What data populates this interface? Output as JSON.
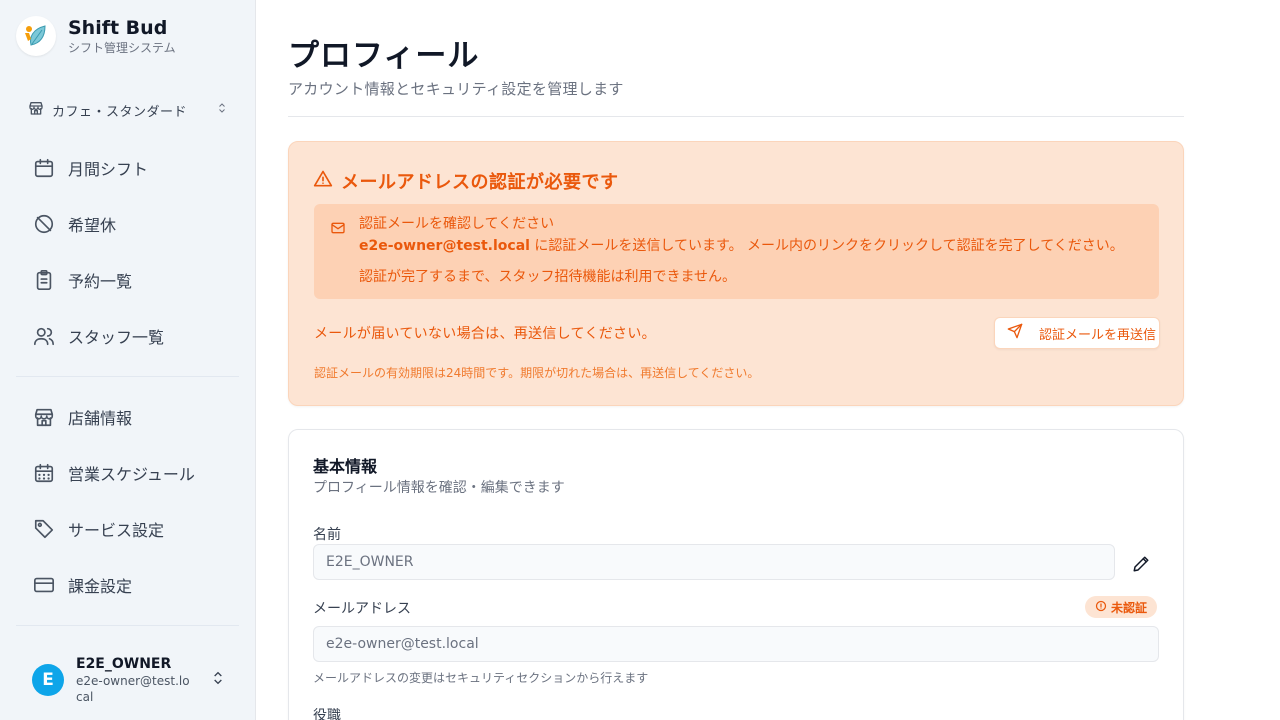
{
  "brand": {
    "name": "Shift Bud",
    "subtitle": "シフト管理システム"
  },
  "store_selector": {
    "value": "カフェ・スタンダード"
  },
  "sidebar": {
    "items": [
      {
        "label": "月間シフト",
        "icon": "calendar-icon"
      },
      {
        "label": "希望休",
        "icon": "calendar-off-icon"
      },
      {
        "label": "予約一覧",
        "icon": "clipboard-icon"
      },
      {
        "label": "スタッフ一覧",
        "icon": "users-icon"
      },
      {
        "label": "店舗情報",
        "icon": "store-icon"
      },
      {
        "label": "営業スケジュール",
        "icon": "calendar-grid-icon"
      },
      {
        "label": "サービス設定",
        "icon": "tag-icon"
      },
      {
        "label": "課金設定",
        "icon": "credit-card-icon"
      }
    ]
  },
  "user": {
    "initial": "E",
    "name": "E2E_OWNER",
    "email": "e2e-owner@test.local"
  },
  "page": {
    "title": "プロフィール",
    "subtitle": "アカウント情報とセキュリティ設定を管理します"
  },
  "verification": {
    "title": "メールアドレスの認証が必要です",
    "inner_title": "認証メールを確認してください",
    "email": "e2e-owner@test.local",
    "inner_message": " に認証メールを送信しています。 メール内のリンクをクリックして認証を完了してください。",
    "inner_note": "認証が完了するまで、スタッフ招待機能は利用できません。",
    "resend_prompt": "メールが届いていない場合は、再送信してください。",
    "resend_button": "認証メールを再送信",
    "expiry_note": "認証メールの有効期限は24時間です。期限が切れた場合は、再送信してください。"
  },
  "basic_info": {
    "title": "基本情報",
    "subtitle": "プロフィール情報を確認・編集できます",
    "name_label": "名前",
    "name_value": "E2E_OWNER",
    "email_label": "メールアドレス",
    "email_value": "e2e-owner@test.local",
    "email_badge": "未認証",
    "email_help": "メールアドレスの変更はセキュリティセクションから行えます",
    "role_label": "役職"
  },
  "colors": {
    "accent": "#ea580c",
    "warn_bg": "#fde4d3",
    "avatar": "#0ea5e9"
  }
}
